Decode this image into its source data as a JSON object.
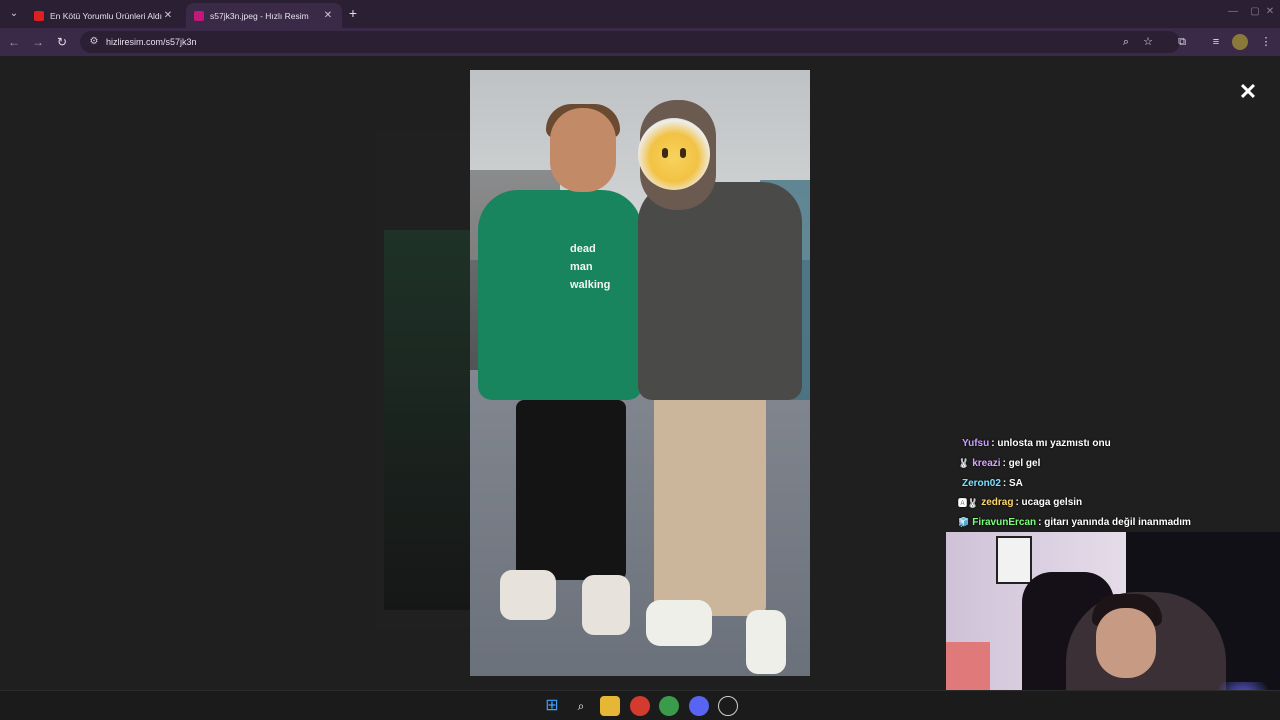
{
  "browser": {
    "tabs": [
      {
        "title": "En Kötü Yorumlu Ürünleri Aldım",
        "active": false,
        "favicon_color": "#e02020"
      },
      {
        "title": "s57jk3n.jpeg - Hızlı Resim",
        "active": true,
        "favicon_color": "#c2187a"
      }
    ],
    "tab_menu_icon": "chevron-down-icon",
    "new_tab_label": "+",
    "close_tab_label": "✕",
    "url": "hizliresim.com/s57jk3n",
    "window_controls": {
      "minimize": "—",
      "maximize": "▢",
      "close": "✕"
    }
  },
  "lightbox": {
    "close_label": "✕",
    "hoodie_text": [
      "dead",
      "man",
      "walking"
    ]
  },
  "chat": {
    "messages": [
      {
        "user": "Yufsu",
        "text": ": unlosta mı yazmıstı onu",
        "color": "#c9a0ff",
        "badge": ""
      },
      {
        "user": "kreazi",
        "text": ": gel gel",
        "color": "#d7a6ff",
        "badge": "🐰"
      },
      {
        "user": "Zeron02",
        "text": ": SA",
        "color": "#7fe0ff",
        "badge": ""
      },
      {
        "user": "zedrag",
        "text": ": ucaga gelsin",
        "color": "#ffd86a",
        "badge": "🅰🐰"
      },
      {
        "user": "FiravunErcan",
        "text": ": gitarı yanında değil inanmadım",
        "color": "#7dff7d",
        "badge": "🧊"
      }
    ]
  },
  "taskbar": {
    "items": [
      "windows-start",
      "search",
      "file-explorer",
      "chrome",
      "chrome-profile",
      "discord",
      "other-app"
    ]
  }
}
